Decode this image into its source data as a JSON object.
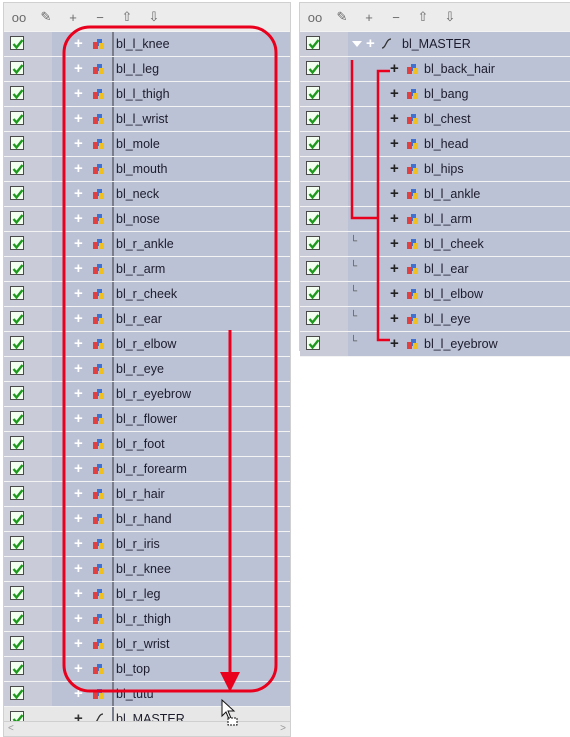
{
  "toolbar_icons": [
    "glasses-icon",
    "lock-icon",
    "add-icon",
    "remove-icon",
    "up-level-icon",
    "down-level-icon"
  ],
  "toolbar_glyphs": [
    "oo",
    "✎",
    "+",
    "−",
    "⇧",
    "⇩"
  ],
  "left_panel": {
    "rows": [
      {
        "label": "bl_l_knee"
      },
      {
        "label": "bl_l_leg"
      },
      {
        "label": "bl_l_thigh"
      },
      {
        "label": "bl_l_wrist"
      },
      {
        "label": "bl_mole"
      },
      {
        "label": "bl_mouth"
      },
      {
        "label": "bl_neck"
      },
      {
        "label": "bl_nose"
      },
      {
        "label": "bl_r_ankle"
      },
      {
        "label": "bl_r_arm"
      },
      {
        "label": "bl_r_cheek"
      },
      {
        "label": "bl_r_ear"
      },
      {
        "label": "bl_r_elbow"
      },
      {
        "label": "bl_r_eye"
      },
      {
        "label": "bl_r_eyebrow"
      },
      {
        "label": "bl_r_flower"
      },
      {
        "label": "bl_r_foot"
      },
      {
        "label": "bl_r_forearm"
      },
      {
        "label": "bl_r_hair"
      },
      {
        "label": "bl_r_hand"
      },
      {
        "label": "bl_r_iris"
      },
      {
        "label": "bl_r_knee"
      },
      {
        "label": "bl_r_leg"
      },
      {
        "label": "bl_r_thigh"
      },
      {
        "label": "bl_r_wrist"
      },
      {
        "label": "bl_top"
      },
      {
        "label": "bl_tutu"
      }
    ],
    "master_label": "bl_MASTER"
  },
  "right_panel": {
    "master_label": "bl_MASTER",
    "rows": [
      {
        "label": "bl_back_hair"
      },
      {
        "label": "bl_bang"
      },
      {
        "label": "bl_chest"
      },
      {
        "label": "bl_head"
      },
      {
        "label": "bl_hips"
      },
      {
        "label": "bl_l_ankle"
      },
      {
        "label": "bl_l_arm"
      },
      {
        "label": "bl_l_cheek"
      },
      {
        "label": "bl_l_ear"
      },
      {
        "label": "bl_l_elbow"
      },
      {
        "label": "bl_l_eye"
      },
      {
        "label": "bl_l_eyebrow"
      }
    ]
  },
  "colors": {
    "highlight_red": "#e8001c",
    "row_blue": "#bcc2d6",
    "check_green": "#1e9a1e"
  }
}
